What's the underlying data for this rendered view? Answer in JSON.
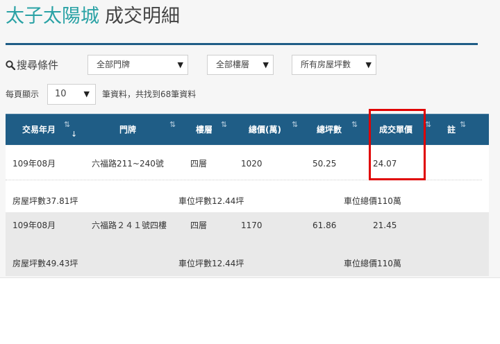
{
  "header": {
    "title_main": "太子太陽城",
    "title_sub": "成交明細"
  },
  "filters": {
    "label": "搜尋條件",
    "door_select": "全部門牌",
    "floor_select": "全部樓層",
    "area_select": "所有房屋坪數",
    "caret": "▼"
  },
  "paging": {
    "per_page_label": "每頁顯示",
    "page_size": "10",
    "found_text": "筆資料，共找到68筆資料"
  },
  "table": {
    "columns": [
      "交易年月",
      "門牌",
      "樓層",
      "總價(萬)",
      "總坪數",
      "成交單價",
      "註"
    ],
    "sort_glyph": "⇅",
    "sort_glyph_active": "↓",
    "rows": [
      {
        "date": "109年08月",
        "address": "六福路211~240號",
        "floor": "四層",
        "total_price": "1020",
        "total_area": "50.25",
        "unit_price": "24.07",
        "house_area": "房屋坪數37.81坪",
        "parking_area": "車位坪數12.44坪",
        "parking_price": "車位總價110萬"
      },
      {
        "date": "109年08月",
        "address": "六福路２４１號四樓",
        "floor": "四層",
        "total_price": "1170",
        "total_area": "61.86",
        "unit_price": "21.45",
        "house_area": "房屋坪數49.43坪",
        "parking_area": "車位坪數12.44坪",
        "parking_price": "車位總價110萬"
      }
    ]
  },
  "annotation": {
    "color": "#e00000",
    "target": "成交單價"
  },
  "colors": {
    "title_accent": "#2aa2a5",
    "header_bg": "#1f5d86"
  }
}
